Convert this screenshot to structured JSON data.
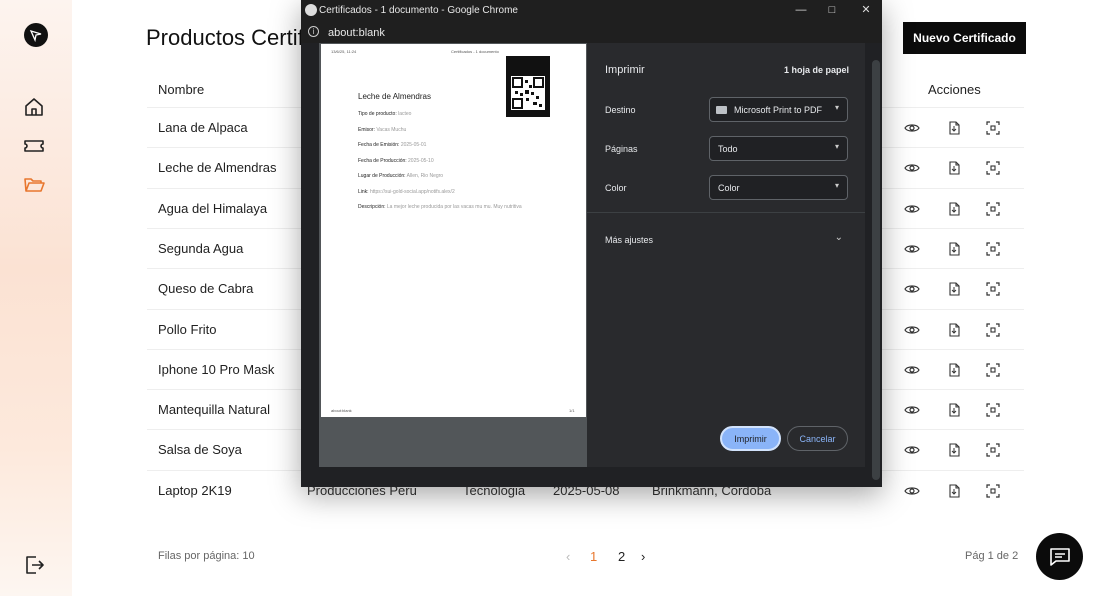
{
  "sidebar": {
    "icons": [
      "logo-icon",
      "home-icon",
      "ticket-icon",
      "folder-icon",
      "logout-icon"
    ]
  },
  "page": {
    "title": "Productos Certificados",
    "new_button": "Nuevo Certificado",
    "headers": {
      "name": "Nombre",
      "actions": "Acciones"
    },
    "rows": [
      {
        "name": "Lana de Alpaca"
      },
      {
        "name": "Leche de Almendras"
      },
      {
        "name": "Agua del Himalaya"
      },
      {
        "name": "Segunda Agua"
      },
      {
        "name": "Queso de Cabra"
      },
      {
        "name": "Pollo Frito"
      },
      {
        "name": "Iphone 10 Pro Mask"
      },
      {
        "name": "Mantequilla Natural"
      },
      {
        "name": "Salsa de Soya"
      },
      {
        "name": "Laptop 2K19",
        "issuer": "Producciones Peru",
        "type": "Tecnologia",
        "date": "2025-05-08",
        "place": "Brinkmann, Cordoba"
      }
    ],
    "footer": {
      "rows_per_page": "Filas por página: 10",
      "pages": [
        "1",
        "2"
      ],
      "current_page": "1",
      "page_info": "Pág 1 de 2"
    },
    "accent": "#e8772e"
  },
  "chrome": {
    "window_title": "Certificados - 1 documento - Google Chrome",
    "url": "about:blank",
    "preview": {
      "header_left": "13/6/25, 11:24",
      "header_right": "Certificados - 1 documento",
      "title": "Leche de Almendras",
      "fields": [
        {
          "label": "Tipo de producto:",
          "value": "lacteo"
        },
        {
          "label": "Emisor:",
          "value": "Vacas Muchu"
        },
        {
          "label": "Fecha de Emisión:",
          "value": "2025-05-01"
        },
        {
          "label": "Fecha de Producción:",
          "value": "2025-05-10"
        },
        {
          "label": "Lugar de Producción:",
          "value": "Allen, Rio Negro"
        },
        {
          "label": "Link:",
          "value": "https://sui-gold-social.app/notifs.alex/2"
        },
        {
          "label": "Descripción:",
          "value": "La mejor leche producida por las vacas mu mu. Muy nutritiva"
        }
      ],
      "footer_left": "about:blank",
      "footer_right": "1/1"
    },
    "settings": {
      "title": "Imprimir",
      "sheets": "1 hoja de papel",
      "destination_label": "Destino",
      "destination_value": "Microsoft Print to PDF",
      "pages_label": "Páginas",
      "pages_value": "Todo",
      "color_label": "Color",
      "color_value": "Color",
      "more_settings": "Más ajustes",
      "print_button": "Imprimir",
      "cancel_button": "Cancelar"
    }
  }
}
